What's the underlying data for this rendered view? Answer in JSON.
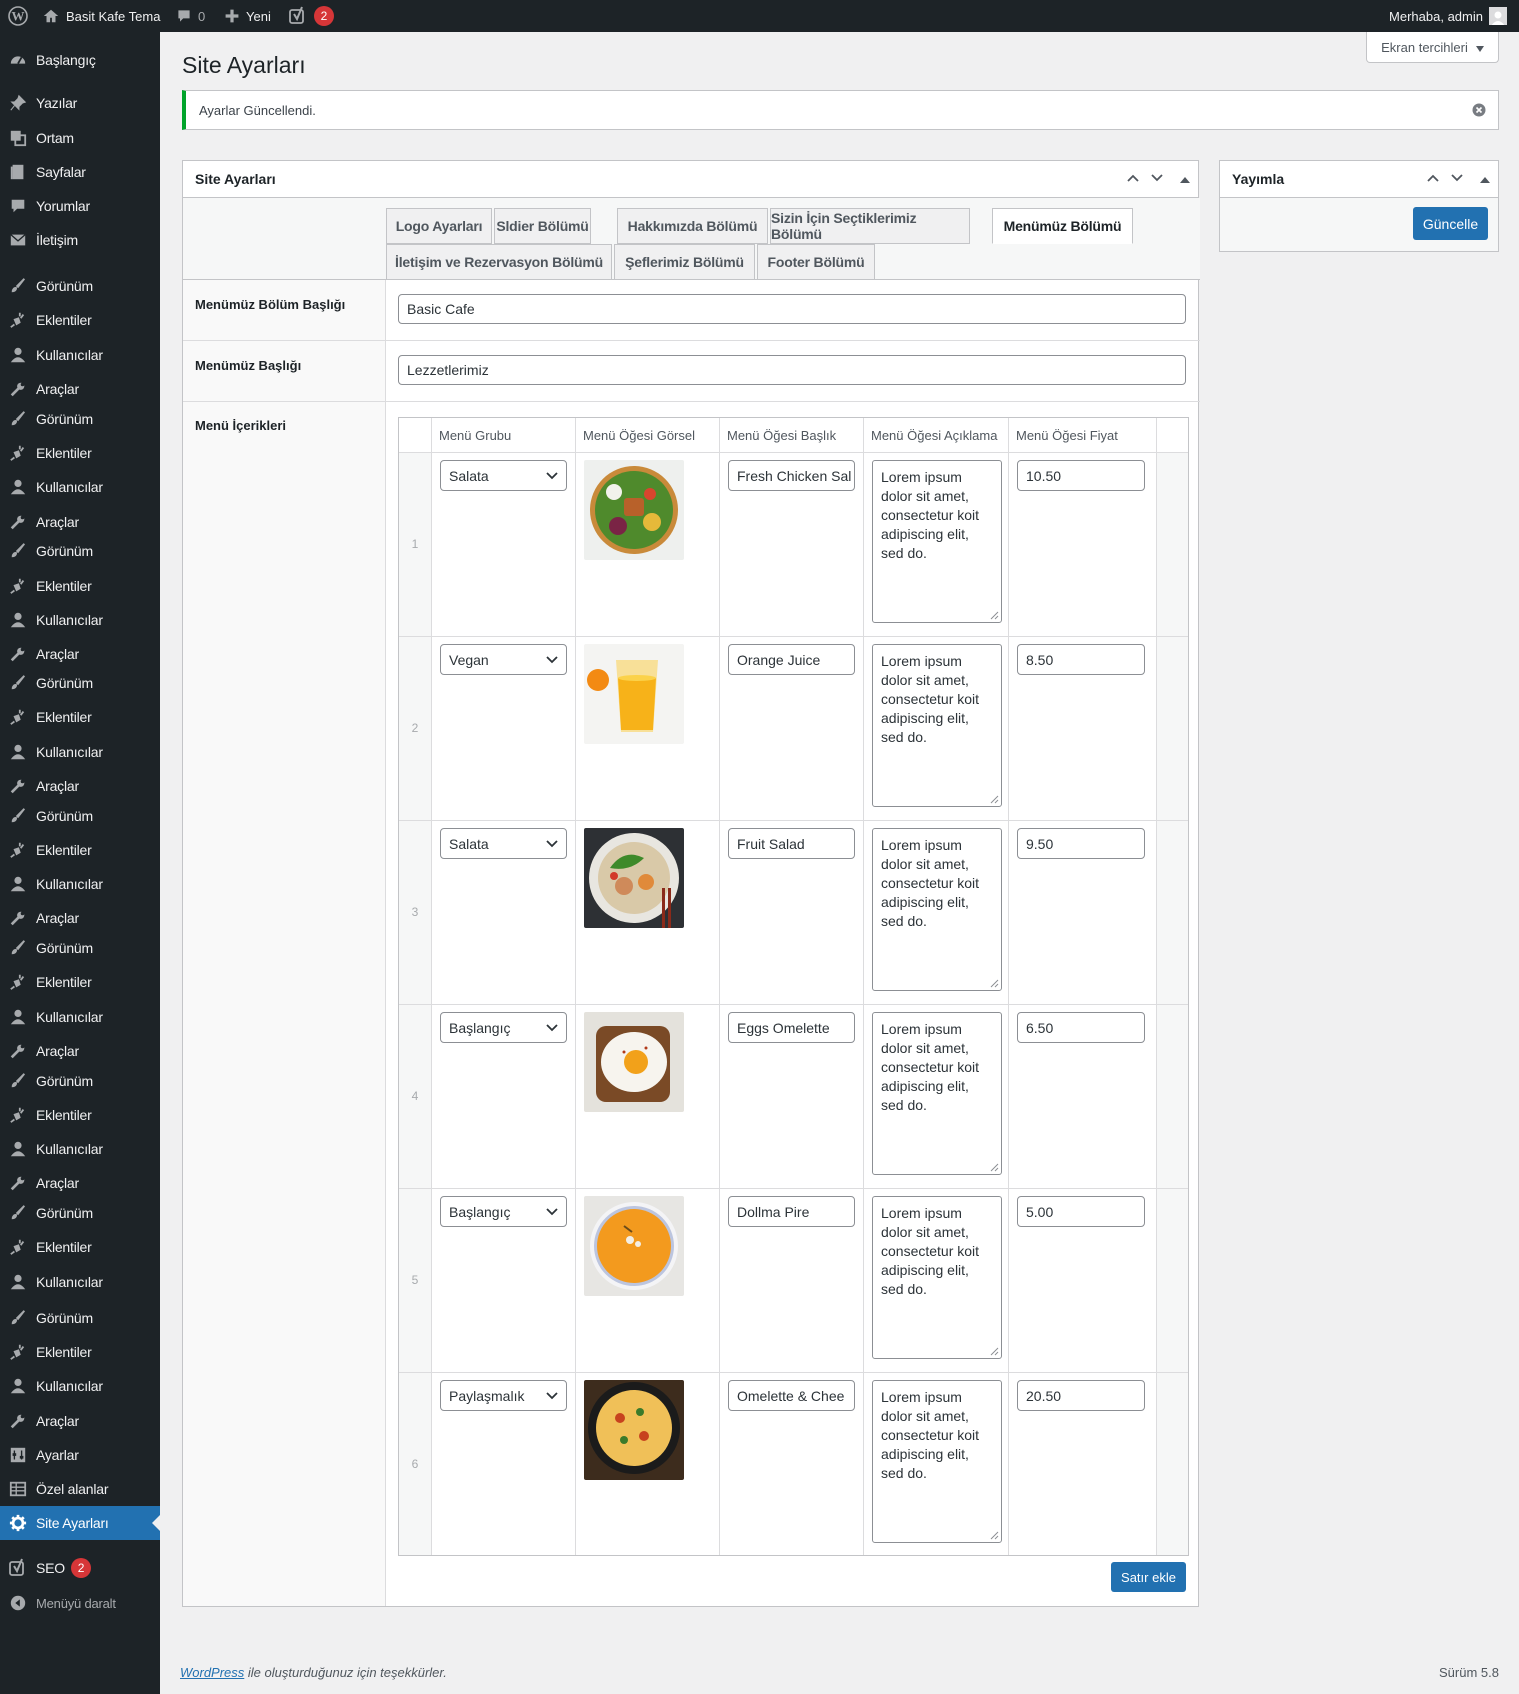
{
  "admin_bar": {
    "site_name": "Basit Kafe Tema",
    "comments_count": "0",
    "new_label": "Yeni",
    "seo_count": "2",
    "greeting": "Merhaba, admin"
  },
  "sidebar": {
    "items": [
      {
        "label": "Başlangıç",
        "icon": "dashboard-icon"
      },
      {
        "label": "Yazılar",
        "icon": "pin-icon"
      },
      {
        "label": "Ortam",
        "icon": "media-icon"
      },
      {
        "label": "Sayfalar",
        "icon": "page-icon"
      },
      {
        "label": "Yorumlar",
        "icon": "comment-icon"
      },
      {
        "label": "İletişim",
        "icon": "mail-icon"
      },
      {
        "label": "Görünüm",
        "icon": "brush-icon"
      },
      {
        "label": "Eklentiler",
        "icon": "plugin-icon"
      },
      {
        "label": "Kullanıcılar",
        "icon": "user-icon"
      },
      {
        "label": "Araçlar",
        "icon": "wrench-icon"
      },
      {
        "label": "Görünüm",
        "icon": "brush-icon"
      },
      {
        "label": "Eklentiler",
        "icon": "plugin-icon"
      },
      {
        "label": "Kullanıcılar",
        "icon": "user-icon"
      },
      {
        "label": "Araçlar",
        "icon": "wrench-icon"
      },
      {
        "label": "Görünüm",
        "icon": "brush-icon"
      },
      {
        "label": "Eklentiler",
        "icon": "plugin-icon"
      },
      {
        "label": "Kullanıcılar",
        "icon": "user-icon"
      },
      {
        "label": "Araçlar",
        "icon": "wrench-icon"
      },
      {
        "label": "Görünüm",
        "icon": "brush-icon"
      },
      {
        "label": "Eklentiler",
        "icon": "plugin-icon"
      },
      {
        "label": "Kullanıcılar",
        "icon": "user-icon"
      },
      {
        "label": "Araçlar",
        "icon": "wrench-icon"
      },
      {
        "label": "Görünüm",
        "icon": "brush-icon"
      },
      {
        "label": "Eklentiler",
        "icon": "plugin-icon"
      },
      {
        "label": "Kullanıcılar",
        "icon": "user-icon"
      },
      {
        "label": "Araçlar",
        "icon": "wrench-icon"
      },
      {
        "label": "Görünüm",
        "icon": "brush-icon"
      },
      {
        "label": "Eklentiler",
        "icon": "plugin-icon"
      },
      {
        "label": "Kullanıcılar",
        "icon": "user-icon"
      },
      {
        "label": "Araçlar",
        "icon": "wrench-icon"
      },
      {
        "label": "Görünüm",
        "icon": "brush-icon"
      },
      {
        "label": "Eklentiler",
        "icon": "plugin-icon"
      },
      {
        "label": "Kullanıcılar",
        "icon": "user-icon"
      },
      {
        "label": "Araçlar",
        "icon": "wrench-icon"
      },
      {
        "label": "Görünüm",
        "icon": "brush-icon"
      },
      {
        "label": "Eklentiler",
        "icon": "plugin-icon"
      },
      {
        "label": "Kullanıcılar",
        "icon": "user-icon"
      },
      {
        "label": "Görünüm",
        "icon": "brush-icon"
      },
      {
        "label": "Eklentiler",
        "icon": "plugin-icon"
      },
      {
        "label": "Kullanıcılar",
        "icon": "user-icon"
      },
      {
        "label": "Araçlar",
        "icon": "wrench-icon"
      },
      {
        "label": "Ayarlar",
        "icon": "settings-icon"
      },
      {
        "label": "Özel alanlar",
        "icon": "table-icon"
      },
      {
        "label": "Site Ayarları",
        "icon": "gear-icon",
        "active": true
      },
      {
        "label": "SEO",
        "icon": "yoast-icon",
        "badge": "2"
      },
      {
        "label": "Menüyü daralt",
        "icon": "collapse-icon"
      }
    ]
  },
  "screen_options": "Ekran tercihleri",
  "page_title": "Site Ayarları",
  "notice": "Ayarlar Güncellendi.",
  "settings_box": {
    "title": "Site Ayarları",
    "tabs": [
      "Logo Ayarları",
      "Sldier Bölümü",
      "Hakkımızda Bölümü",
      "Sizin İçin Seçtiklerimiz Bölümü",
      "Menümüz Bölümü",
      "İletişim ve Rezervasyon Bölümü",
      "Şeflerimiz Bölümü",
      "Footer Bölümü"
    ],
    "active_tab": "Menümüz Bölümü",
    "fields": {
      "section_title_label": "Menümüz Bölüm Başlığı",
      "section_title_value": "Basic Cafe",
      "menu_title_label": "Menümüz Başlığı",
      "menu_title_value": "Lezzetlerimiz",
      "menu_items_label": "Menü İçerikleri"
    },
    "table": {
      "headers": [
        "Menü Grubu",
        "Menü Öğesi Görsel",
        "Menü Öğesi Başlık",
        "Menü Öğesi Açıklama",
        "Menü Öğesi Fiyat"
      ],
      "rows": [
        {
          "num": "1",
          "group": "Salata",
          "image": "salad-bowl-image",
          "title": "Fresh Chicken Sal",
          "description": "Lorem ipsum dolor sit amet, consectetur koit adipiscing elit, sed do.",
          "price": "10.50"
        },
        {
          "num": "2",
          "group": "Vegan",
          "image": "orange-juice-image",
          "title": "Orange Juice",
          "description": "Lorem ipsum dolor sit amet, consectetur koit adipiscing elit, sed do.",
          "price": "8.50"
        },
        {
          "num": "3",
          "group": "Salata",
          "image": "fruit-salad-image",
          "title": "Fruit Salad",
          "description": "Lorem ipsum dolor sit amet, consectetur koit adipiscing elit, sed do.",
          "price": "9.50"
        },
        {
          "num": "4",
          "group": "Başlangıç",
          "image": "egg-toast-image",
          "title": "Eggs Omelette",
          "description": "Lorem ipsum dolor sit amet, consectetur koit adipiscing elit, sed do.",
          "price": "6.50"
        },
        {
          "num": "5",
          "group": "Başlangıç",
          "image": "pumpkin-soup-image",
          "title": "Dollma Pire",
          "description": "Lorem ipsum dolor sit amet, consectetur koit adipiscing elit, sed do.",
          "price": "5.00"
        },
        {
          "num": "6",
          "group": "Paylaşmalık",
          "image": "skillet-omelette-image",
          "title": "Omelette & Chee",
          "description": "Lorem ipsum dolor sit amet, consectetur koit adipiscing elit, sed do.",
          "price": "20.50"
        }
      ]
    },
    "add_row_label": "Satır ekle"
  },
  "publish_box": {
    "title": "Yayımla",
    "update_label": "Güncelle"
  },
  "footer": {
    "link": "WordPress",
    "text": " ile oluşturduğunuz için teşekkürler.",
    "version": "Sürüm 5.8"
  },
  "colors": {
    "accent": "#2271b1",
    "sidebar_bg": "#1d2327",
    "notice_success": "#00a32a",
    "badge": "#d63638"
  }
}
